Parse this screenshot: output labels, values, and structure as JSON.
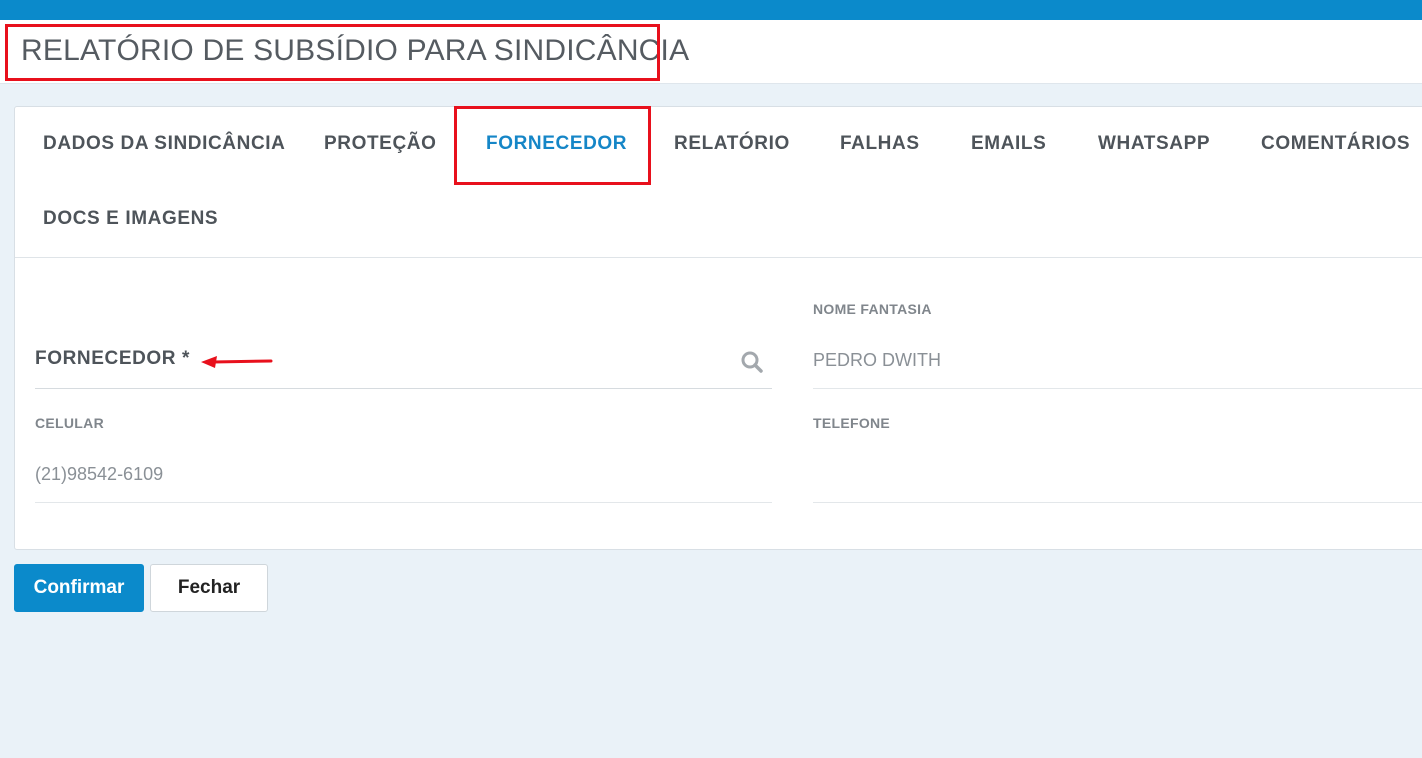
{
  "header": {
    "title": "RELATÓRIO DE SUBSÍDIO PARA SINDICÂNCIA"
  },
  "tabs": [
    {
      "label": "DADOS DA SINDICÂNCIA"
    },
    {
      "label": "PROTEÇÃO"
    },
    {
      "label": "FORNECEDOR",
      "active": true
    },
    {
      "label": "RELATÓRIO"
    },
    {
      "label": "FALHAS"
    },
    {
      "label": "EMAILS"
    },
    {
      "label": "WHATSAPP"
    },
    {
      "label": "COMENTÁRIOS"
    },
    {
      "label": "DOCS E IMAGENS"
    }
  ],
  "form": {
    "fornecedor": {
      "label": "FORNECEDOR *",
      "value": "",
      "icon": "search-icon"
    },
    "nome_fantasia": {
      "label": "NOME FANTASIA",
      "value": "PEDRO DWITH"
    },
    "celular": {
      "label": "CELULAR",
      "value": "(21)98542-6109"
    },
    "telefone": {
      "label": "TELEFONE",
      "value": ""
    }
  },
  "actions": {
    "confirm_label": "Confirmar",
    "close_label": "Fechar"
  },
  "colors": {
    "brand": "#0b8acb",
    "active_tab": "#1586c7",
    "annotation": "#e8101c",
    "background": "#eaf2f8"
  }
}
